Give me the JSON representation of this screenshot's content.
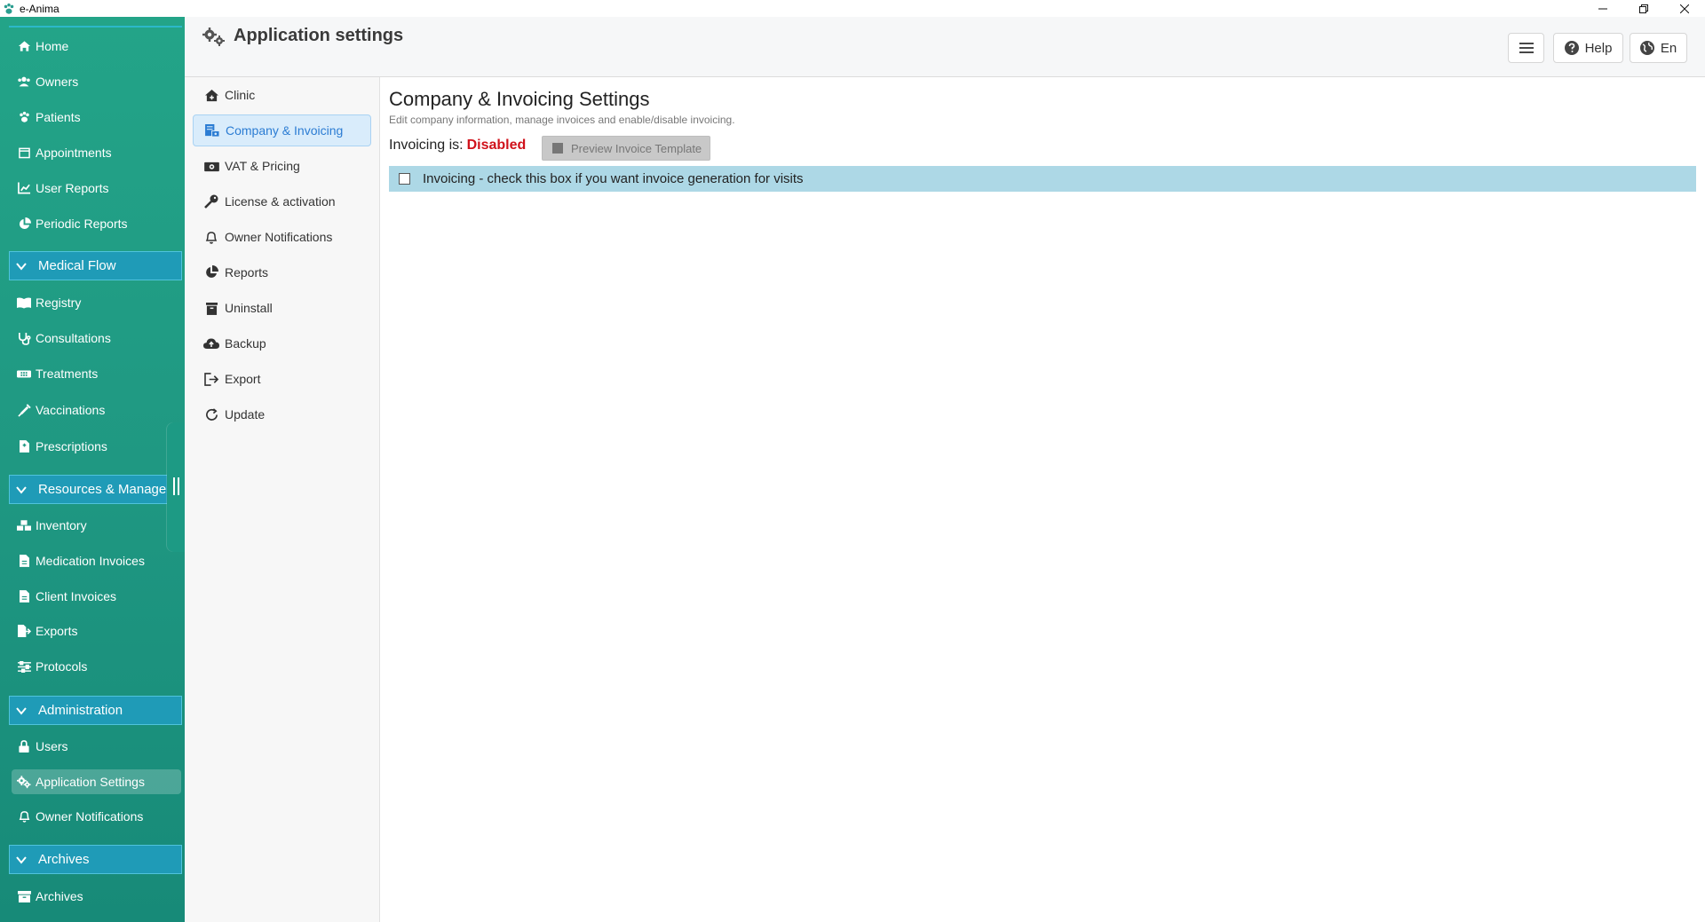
{
  "window": {
    "title": "e-Anima",
    "icon": "paw-icon",
    "controls": [
      "minimize-icon",
      "restore-icon",
      "close-icon"
    ]
  },
  "sidebar": {
    "items_top": [
      {
        "label": "Home",
        "icon": "home-icon"
      },
      {
        "label": "Owners",
        "icon": "users-icon"
      },
      {
        "label": "Patients",
        "icon": "paw-icon"
      },
      {
        "label": "Appointments",
        "icon": "calendar-icon"
      },
      {
        "label": "User Reports",
        "icon": "chart-icon"
      },
      {
        "label": "Periodic Reports",
        "icon": "pie-chart-icon"
      }
    ],
    "sections": [
      {
        "title": "Medical Flow",
        "items": [
          {
            "label": "Registry",
            "icon": "book-icon"
          },
          {
            "label": "Consultations",
            "icon": "stethoscope-icon"
          },
          {
            "label": "Treatments",
            "icon": "bandage-icon"
          },
          {
            "label": "Vaccinations",
            "icon": "syringe-icon"
          },
          {
            "label": "Prescriptions",
            "icon": "prescription-icon"
          }
        ]
      },
      {
        "title": "Resources & Managem",
        "items": [
          {
            "label": "Inventory",
            "icon": "boxes-icon"
          },
          {
            "label": "Medication Invoices",
            "icon": "file-icon"
          },
          {
            "label": "Client Invoices",
            "icon": "file-icon"
          },
          {
            "label": "Exports",
            "icon": "file-export-icon"
          },
          {
            "label": "Protocols",
            "icon": "sliders-icon"
          }
        ]
      },
      {
        "title": "Administration",
        "items": [
          {
            "label": "Users",
            "icon": "lock-icon"
          },
          {
            "label": "Application Settings",
            "icon": "cogs-icon",
            "active": true
          },
          {
            "label": "Owner Notifications",
            "icon": "bell-icon"
          }
        ]
      },
      {
        "title": "Archives",
        "items": [
          {
            "label": "Archives",
            "icon": "archive-icon"
          }
        ]
      }
    ]
  },
  "header": {
    "title": "Application settings",
    "icon": "cogs-icon",
    "menu_icon": "hamburger-icon",
    "help_label": "Help",
    "help_icon": "question-circle-icon",
    "lang_label": "En",
    "lang_icon": "globe-icon"
  },
  "settings_nav": [
    {
      "label": "Clinic",
      "icon": "clinic-icon"
    },
    {
      "label": "Company & Invoicing",
      "icon": "invoice-icon",
      "active": true
    },
    {
      "label": "VAT & Pricing",
      "icon": "money-icon"
    },
    {
      "label": "License & activation",
      "icon": "key-icon"
    },
    {
      "label": "Owner Notifications",
      "icon": "bell-icon"
    },
    {
      "label": "Reports",
      "icon": "pie-chart-icon"
    },
    {
      "label": "Uninstall",
      "icon": "trash-icon"
    },
    {
      "label": "Backup",
      "icon": "cloud-upload-icon"
    },
    {
      "label": "Export",
      "icon": "sign-out-icon"
    },
    {
      "label": "Update",
      "icon": "refresh-icon"
    }
  ],
  "main": {
    "title": "Company & Invoicing Settings",
    "subtitle": "Edit company information, manage invoices and enable/disable invoicing.",
    "invoicing_label": "Invoicing is:",
    "invoicing_status": "Disabled",
    "preview_button": "Preview Invoice Template",
    "preview_icon": "stop-icon",
    "invoice_checkbox_label": "Invoicing - check this box if you want invoice generation for visits",
    "invoice_checked": false
  },
  "colors": {
    "sidebar": "#1f9882",
    "section_header": "#1f9bb7",
    "active_tab_bg": "#d9ecfb",
    "active_tab_text": "#2b7cd3",
    "status_disabled": "#d0121b",
    "invoice_row_bg": "#add8e6"
  }
}
